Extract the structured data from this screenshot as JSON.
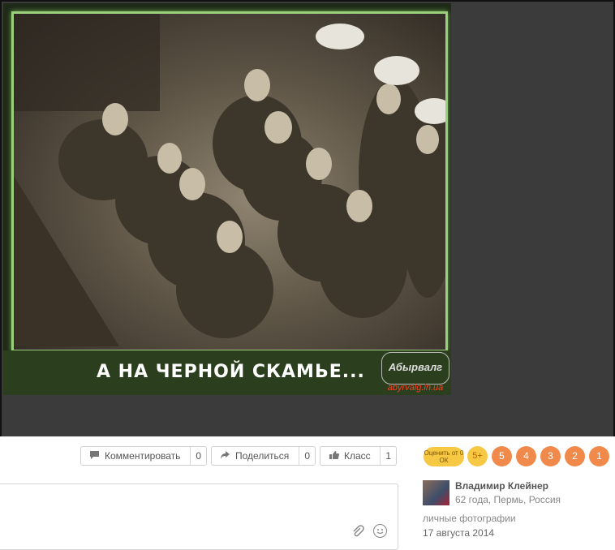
{
  "photo": {
    "caption": "А НА ЧЕРНОЙ СКАМЬЕ...",
    "watermark_url": "abyrvalg.in.ua"
  },
  "actions": {
    "comment": {
      "label": "Комментировать",
      "count": "0",
      "icon": "speech-bubble-icon"
    },
    "share": {
      "label": "Поделиться",
      "count": "0",
      "icon": "share-arrow-icon"
    },
    "like": {
      "label": "Класс",
      "count": "1",
      "icon": "thumbs-up-icon"
    }
  },
  "rating": {
    "label": "Оценить от 0 ОК",
    "options": [
      "5+",
      "5",
      "4",
      "3",
      "2",
      "1"
    ]
  },
  "author": {
    "name": "Владимир Клейнер",
    "meta": "62 года, Пермь, Россия",
    "album": "личные фотографии",
    "date": "17 августа 2014"
  }
}
